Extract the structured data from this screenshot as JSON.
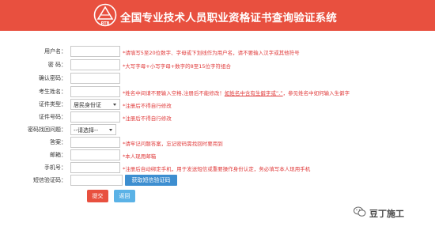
{
  "header": {
    "title": "全国专业技术人员职业资格证书查询验证系统",
    "logo_text": "RTB",
    "bg_color": "#e8503f"
  },
  "form": {
    "username": {
      "label": "用户名：",
      "value": "",
      "hint": "*请填写5至20位数字、字母或下划线作为用户名，请不要输入汉字或其他符号"
    },
    "password": {
      "label": "密  码：",
      "value": "",
      "hint": "*大写字母+小写字母+数字的8至15位字符组合"
    },
    "confirm_password": {
      "label": "确认密码：",
      "value": "",
      "hint": ""
    },
    "name": {
      "label": "考生姓名：",
      "value": "",
      "hint_prefix": "*姓名中间请不要输入空格,注册后不能修改！",
      "hint_link1": "如姓名中含有生僻字或“.”",
      "hint_link2": "，参见姓名中如何输入生僻字"
    },
    "id_type": {
      "label": "证件类型：",
      "value": "居民身份证",
      "hint": "*注册后不得自行修改"
    },
    "id_number": {
      "label": "证件号码：",
      "value": "",
      "hint": "*注册后不得自行修改"
    },
    "security_question": {
      "label": "密码找回问题：",
      "value": "--请选择--",
      "hint": ""
    },
    "answer": {
      "label": "答案：",
      "value": "",
      "hint": "*请牢记问题答案，忘记密码需找回时要用到"
    },
    "email": {
      "label": "邮箱：",
      "value": "",
      "hint": "*本人现用邮箱"
    },
    "phone": {
      "label": "手机号：",
      "value": "",
      "hint": "*注册后自动绑定手机，用于发送短信或重要操作身份认定，务必填写本人现用手机"
    },
    "sms_code": {
      "label": "短信验证码：",
      "value": "",
      "button": "获取短信验证码"
    }
  },
  "actions": {
    "submit": "提交",
    "back": "返回"
  },
  "watermark": {
    "text": "豆丁施工",
    "icon": "wechat-icon"
  }
}
